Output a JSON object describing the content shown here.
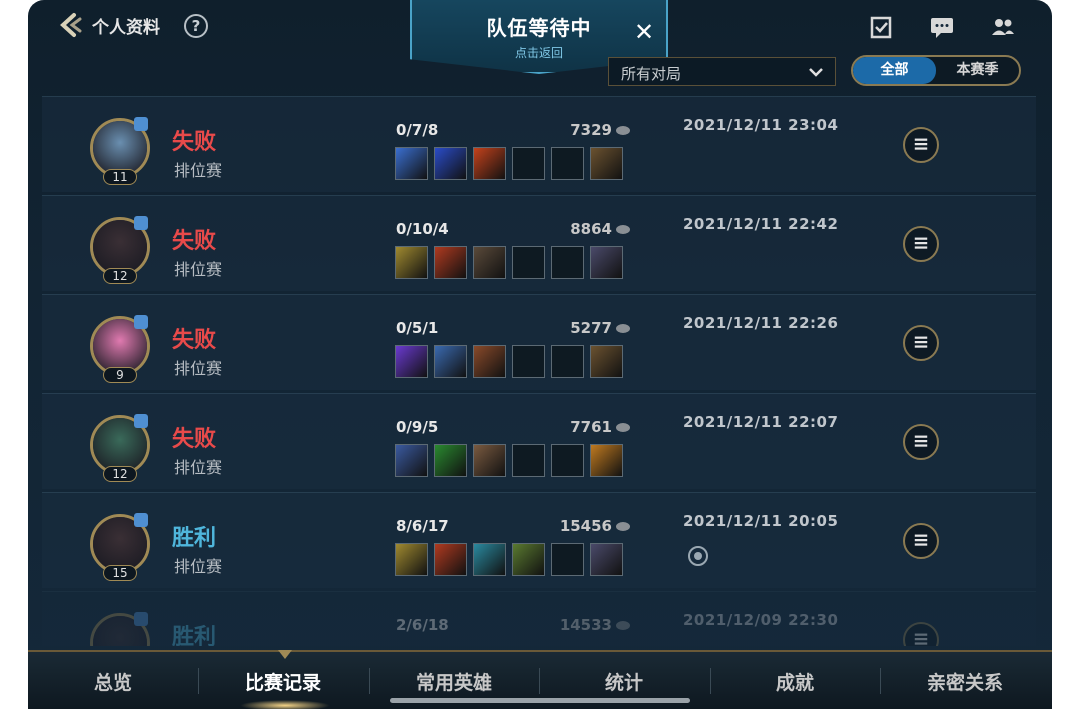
{
  "header": {
    "back_label": "个人资料",
    "help_icon": "?"
  },
  "queue": {
    "title": "队伍等待中",
    "subtitle": "点击返回",
    "close": "✕"
  },
  "top_icons": [
    "missions-icon",
    "chat-icon",
    "friends-icon"
  ],
  "filter": {
    "selected": "所有对局"
  },
  "segment": {
    "options": [
      "全部",
      "本赛季"
    ],
    "active": "全部"
  },
  "colors": {
    "loss": "#e84a4a",
    "win": "#4fb6dc",
    "accent": "#1c6aa8",
    "gold": "#a08a55"
  },
  "matches": [
    {
      "level": "11",
      "result": "失败",
      "outcome": "loss",
      "mode": "排位赛",
      "kda": "0/7/8",
      "gold": "7329",
      "date": "2021/12/11 23:04",
      "avatar_color": "#6a8fb0",
      "items": [
        "#3a6fd0",
        "#2a4cc8",
        "#c4421c",
        "",
        "",
        "#6b5230"
      ],
      "mvp": false
    },
    {
      "level": "12",
      "result": "失败",
      "outcome": "loss",
      "mode": "排位赛",
      "kda": "0/10/4",
      "gold": "8864",
      "date": "2021/12/11 22:42",
      "avatar_color": "#3a2f35",
      "items": [
        "#a08a30",
        "#b03a20",
        "#5a4a3a",
        "",
        "",
        "#4a4a6a"
      ],
      "mvp": false
    },
    {
      "level": "9",
      "result": "失败",
      "outcome": "loss",
      "mode": "排位赛",
      "kda": "0/5/1",
      "gold": "5277",
      "date": "2021/12/11 22:26",
      "avatar_color": "#e07ab0",
      "items": [
        "#6a3ad0",
        "#3a6ab0",
        "#8a4a2a",
        "",
        "",
        "#6b5230"
      ],
      "mvp": false
    },
    {
      "level": "12",
      "result": "失败",
      "outcome": "loss",
      "mode": "排位赛",
      "kda": "0/9/5",
      "gold": "7761",
      "date": "2021/12/11 22:07",
      "avatar_color": "#3a6a5a",
      "items": [
        "#3a5aa0",
        "#2a8a30",
        "#7a5a40",
        "",
        "",
        "#c07a20"
      ],
      "mvp": false
    },
    {
      "level": "15",
      "result": "胜利",
      "outcome": "win",
      "mode": "排位赛",
      "kda": "8/6/17",
      "gold": "15456",
      "date": "2021/12/11 20:05",
      "avatar_color": "#3a2f35",
      "items": [
        "#a08a30",
        "#b03a20",
        "#2a8aa0",
        "#5a7a30",
        "",
        "#4a4a6a"
      ],
      "mvp": true
    },
    {
      "level": "",
      "result": "胜利",
      "outcome": "win",
      "mode": "",
      "kda": "2/6/18",
      "gold": "14533",
      "date": "2021/12/09 22:30",
      "avatar_color": "#3a2f35",
      "items": [],
      "mvp": false
    }
  ],
  "bottom_tabs": [
    "总览",
    "比赛记录",
    "常用英雄",
    "统计",
    "成就",
    "亲密关系"
  ],
  "active_tab": "比赛记录"
}
